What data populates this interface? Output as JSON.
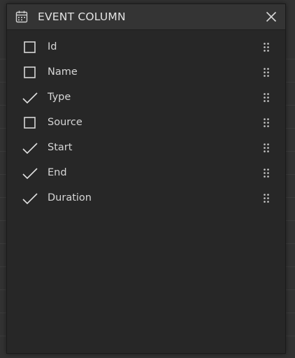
{
  "panel": {
    "title": "EVENT COLUMN",
    "title_icon": "calendar-icon",
    "close_icon": "close-icon"
  },
  "columns": [
    {
      "label": "Id",
      "checked": false
    },
    {
      "label": "Name",
      "checked": false
    },
    {
      "label": "Type",
      "checked": true
    },
    {
      "label": "Source",
      "checked": false
    },
    {
      "label": "Start",
      "checked": true
    },
    {
      "label": "End",
      "checked": true
    },
    {
      "label": "Duration",
      "checked": true
    }
  ],
  "colors": {
    "panel_bg": "#272727",
    "header_bg": "#343434",
    "text": "#d6d6d6",
    "icon": "#d0d0d0"
  }
}
